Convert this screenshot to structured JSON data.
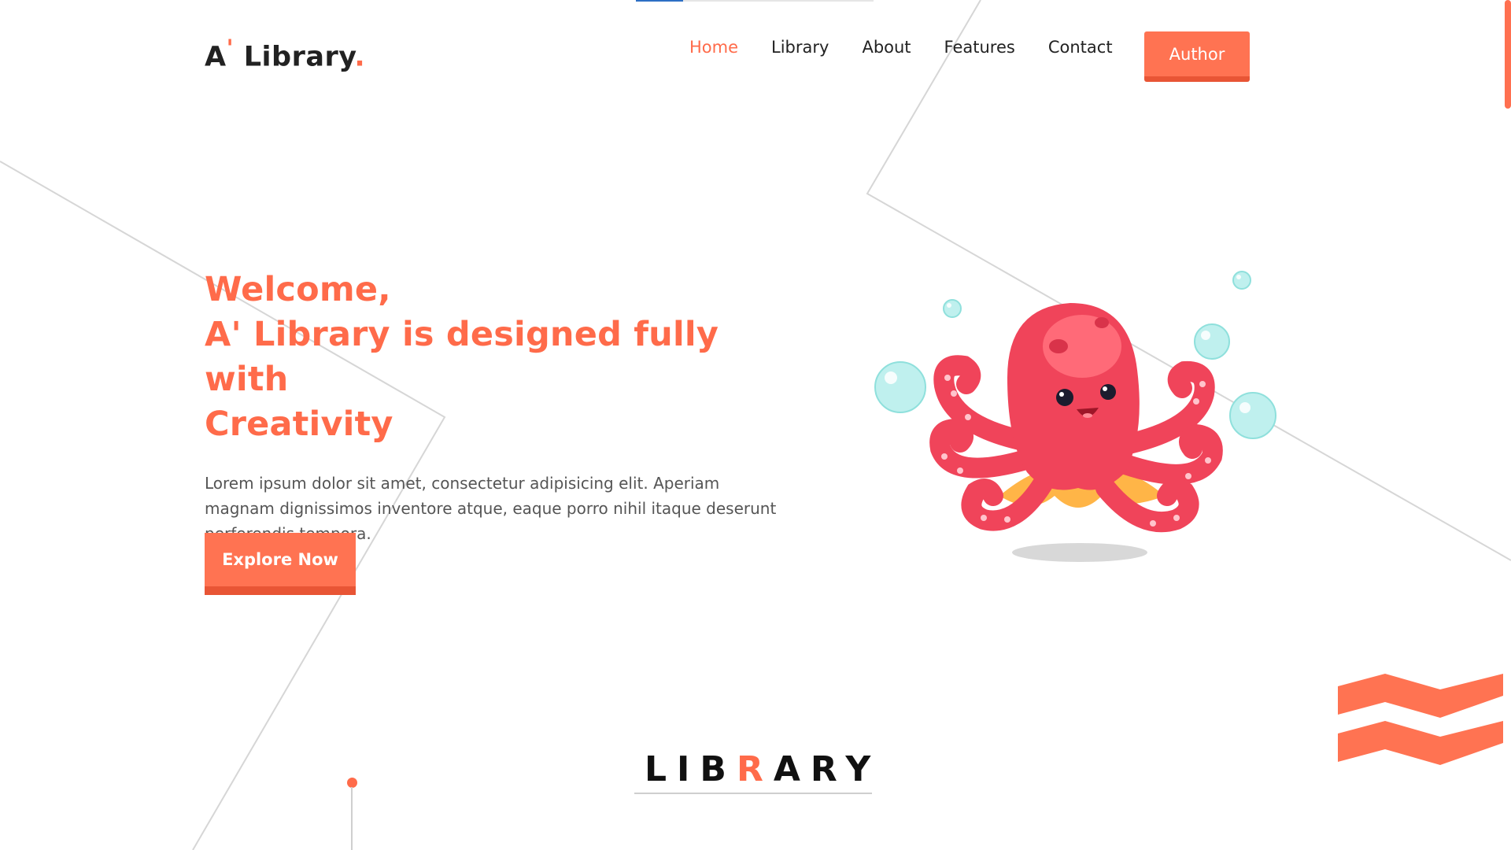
{
  "brand": {
    "name_prefix": "A",
    "apostrophe": "'",
    "name_suffix": " Library",
    "dot": "."
  },
  "nav": {
    "items": [
      {
        "label": "Home",
        "active": true
      },
      {
        "label": "Library",
        "active": false
      },
      {
        "label": "About",
        "active": false
      },
      {
        "label": "Features",
        "active": false
      },
      {
        "label": "Contact",
        "active": false
      }
    ],
    "cta_label": "Author"
  },
  "hero": {
    "heading_line1": "Welcome,",
    "heading_line2": "A' Library is designed fully with",
    "heading_line3": "Creativity",
    "paragraph": "Lorem ipsum dolor sit amet, consectetur adipisicing elit. Aperiam magnam dignissimos inventore atque, eaque porro nihil itaque deserunt perferendis tempora.",
    "button_label": "Explore Now"
  },
  "section": {
    "title_part1": "LIB",
    "title_highlight": "R",
    "title_part2": "ARY"
  },
  "colors": {
    "accent": "#ff6b4a",
    "button": "#ff7352",
    "button_shadow": "#e85535",
    "text_dark": "#222222",
    "nav_indicator": "#2d6fc4"
  },
  "icons": {
    "hero_illustration": "octopus-illustration",
    "decor": "chevron-stripes-icon"
  }
}
